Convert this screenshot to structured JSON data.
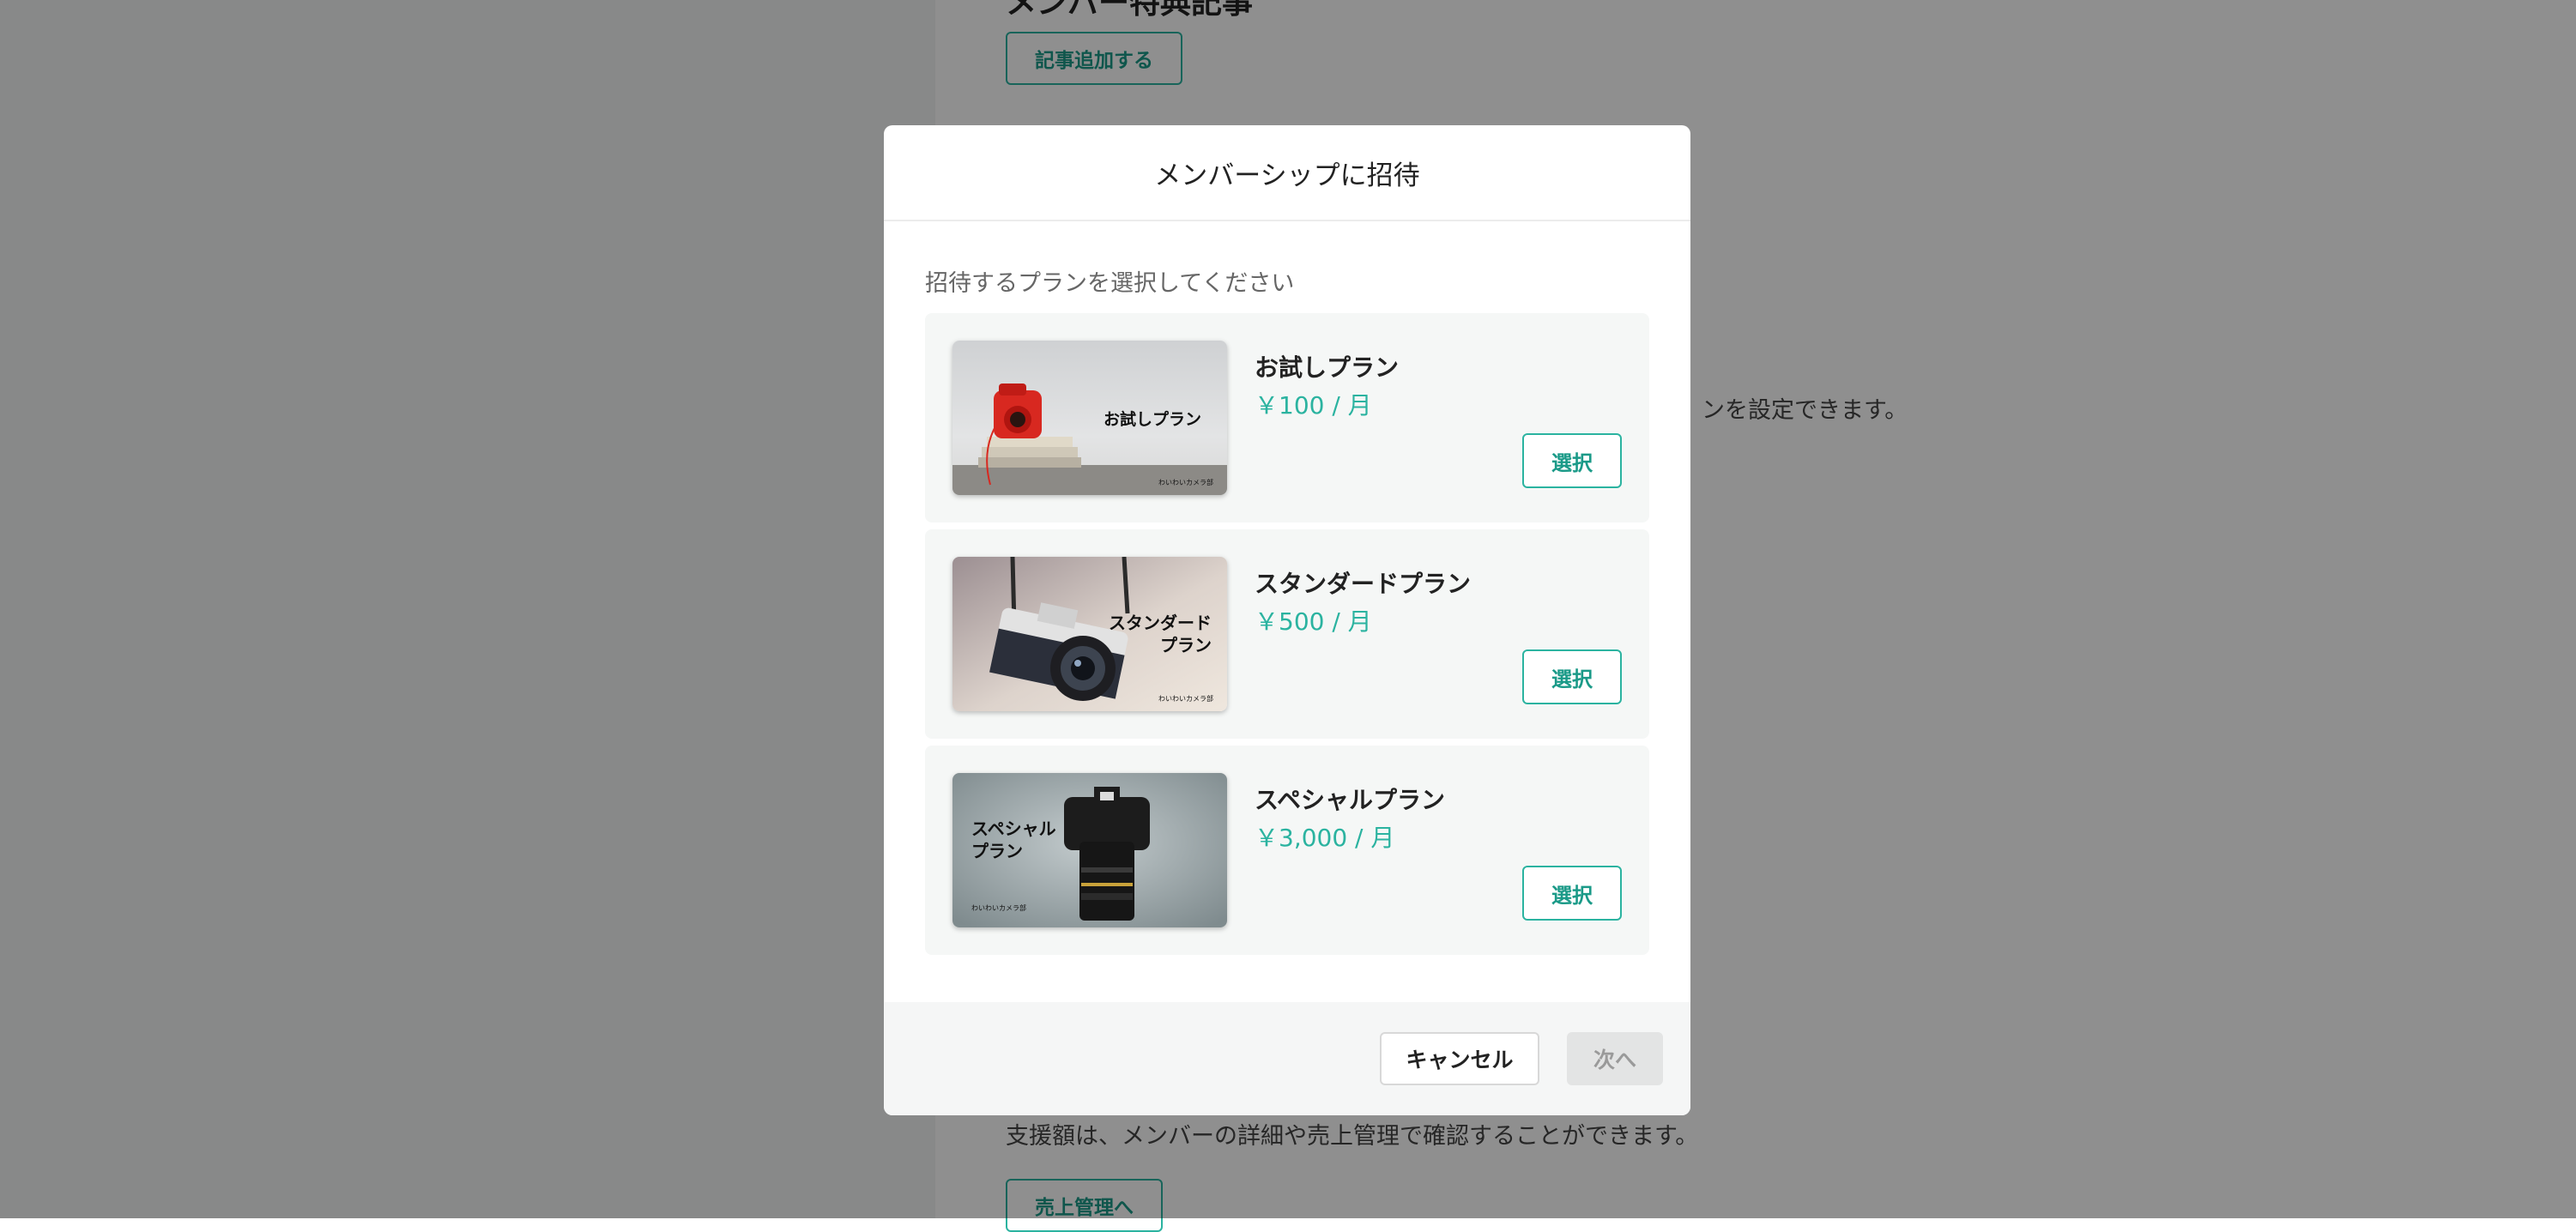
{
  "background": {
    "section_heading": "メンバー特典記事",
    "add_article_button": "記事追加する",
    "partial_text": "ンを設定できます。",
    "support_text": "支援額は、メンバーの詳細や売上管理で確認することができます。",
    "sales_button": "売上管理へ"
  },
  "modal": {
    "title": "メンバーシップに招待",
    "instruction": "招待するプランを選択してください",
    "plans": [
      {
        "name": "お試しプラン",
        "price": "￥100 / 月",
        "thumb_title": "お試しプラン",
        "thumb_credit": "わいわいカメラ部",
        "select_label": "選択"
      },
      {
        "name": "スタンダードプラン",
        "price": "￥500 / 月",
        "thumb_title_line1": "スタンダード",
        "thumb_title_line2": "プラン",
        "thumb_credit": "わいわいカメラ部",
        "select_label": "選択"
      },
      {
        "name": "スペシャルプラン",
        "price": "￥3,000 / 月",
        "thumb_title_line1": "スペシャル",
        "thumb_title_line2": "プラン",
        "thumb_credit": "わいわいカメラ部",
        "select_label": "選択"
      }
    ],
    "cancel_label": "キャンセル",
    "next_label": "次へ"
  },
  "colors": {
    "accent": "#2bb3a0",
    "overlay": "rgba(0,0,0,0.44)",
    "disabled_button": "#e3e4e4"
  }
}
